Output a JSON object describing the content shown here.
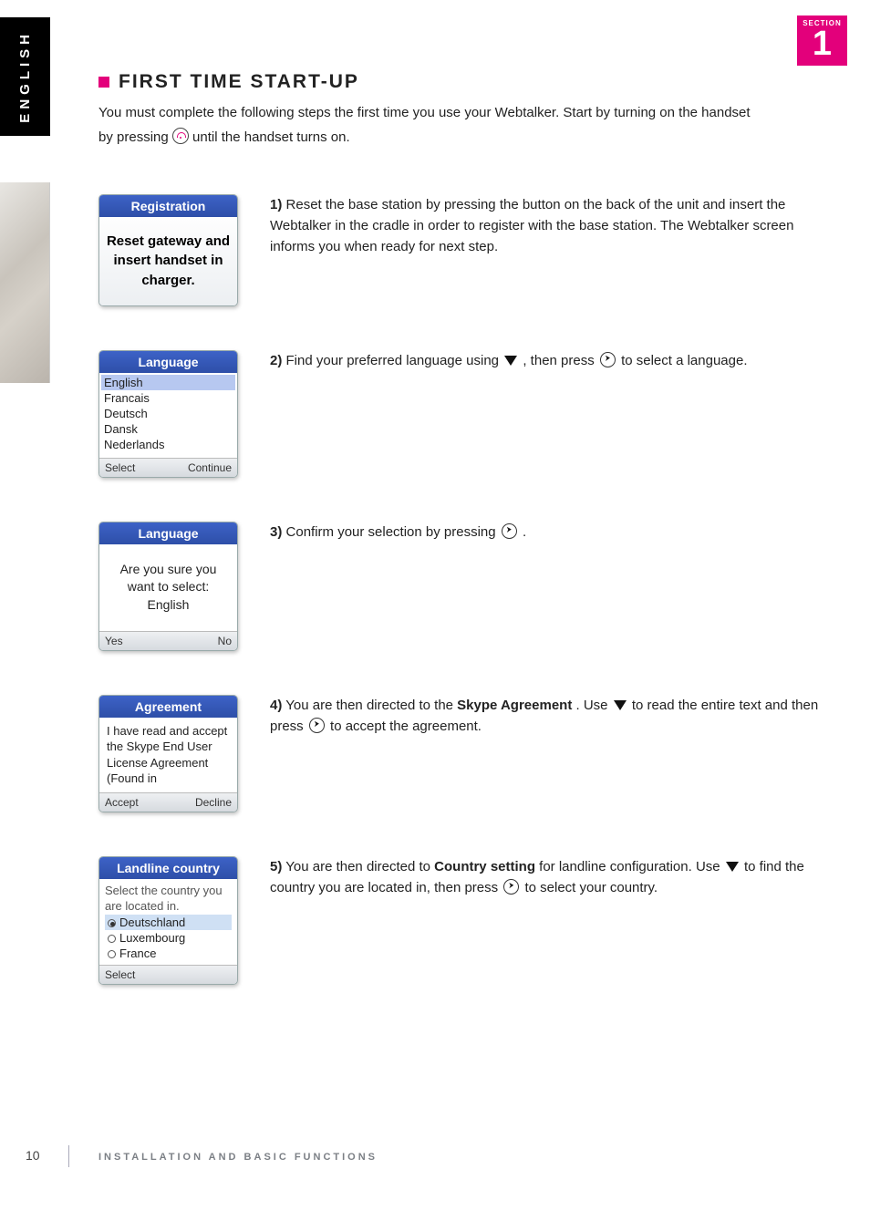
{
  "sideTab": "ENGLISH",
  "section": {
    "label": "SECTION",
    "number": "1"
  },
  "heading": "First Time Start-up",
  "intro": {
    "line1": "You must complete the following steps the first time you use your Webtalker. Start by turning on the handset",
    "line2a": "by pressing ",
    "line2b": " until the handset turns on."
  },
  "steps": [
    {
      "num": "1)",
      "text": "Reset the base station by pressing the button on the back of the unit and insert the Webtalker in the cradle in order to register with the base station. The Webtalker screen informs you when ready for next step.",
      "screen": {
        "title": "Registration",
        "message": "Reset gateway and insert handset in charger."
      }
    },
    {
      "num": "2)",
      "textPre": "Find your preferred language using ",
      "textMid": " , then press ",
      "textPost": " to select a language.",
      "screen": {
        "title": "Language",
        "langs": [
          "English",
          "Francais",
          "Deutsch",
          "Dansk",
          "Nederlands"
        ],
        "footLeft": "Select",
        "footRight": "Continue"
      }
    },
    {
      "num": "3)",
      "textPre": "Confirm your selection by pressing ",
      "textPost": " .",
      "screen": {
        "title": "Language",
        "confirm1": "Are you sure you",
        "confirm2": "want to select:",
        "confirm3": "English",
        "footLeft": "Yes",
        "footRight": "No"
      }
    },
    {
      "num": "4)",
      "textPre": "You are then directed to the ",
      "bold": "Skype Agreement",
      "textMid1": ". Use ",
      "textMid2": " to read the entire text and then press ",
      "textPost": " to accept the agreement.",
      "screen": {
        "title": "Agreement",
        "body": "I have read and accept the Skype End User License Agreement (Found in",
        "footLeft": "Accept",
        "footRight": "Decline"
      }
    },
    {
      "num": "5)",
      "textPre": "You are then directed to ",
      "bold": "Country setting",
      "textMid1": " for landline configuration. Use ",
      "textMid2": " to find the country you are located in, then press ",
      "textPost": " to select your country.",
      "screen": {
        "title": "Landline country",
        "intro": "Select the country you are located in.",
        "countries": [
          "Deutschland",
          "Luxembourg",
          "France"
        ],
        "footLeft": "Select"
      }
    }
  ],
  "pageNumber": "10",
  "footer": "INSTALLATION AND BASIC FUNCTIONS"
}
